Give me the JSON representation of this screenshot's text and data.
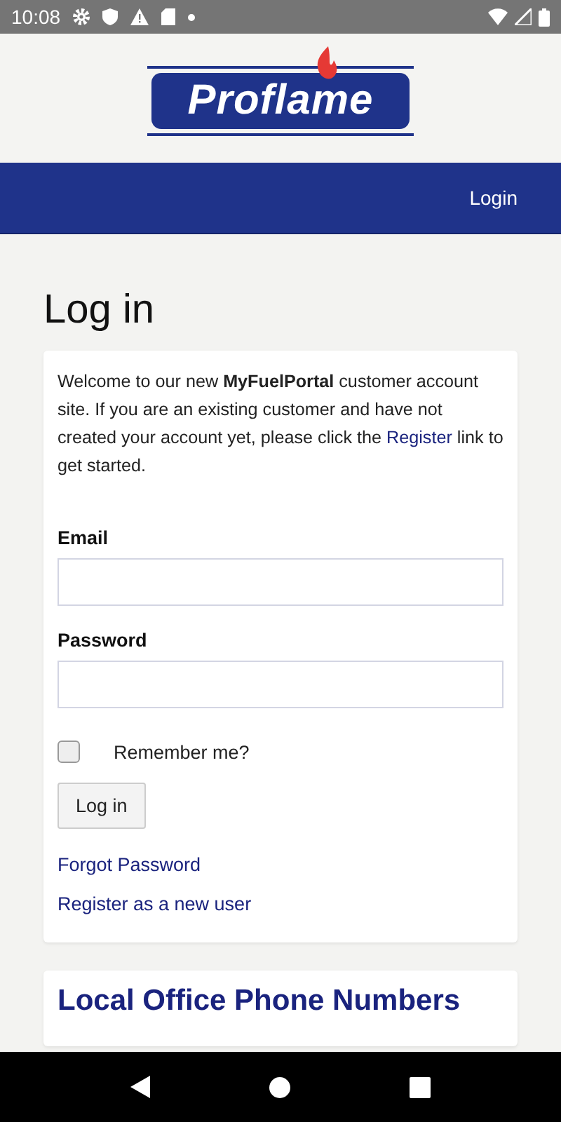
{
  "status_bar": {
    "time": "10:08"
  },
  "header": {
    "logo_text": "Proflame"
  },
  "nav": {
    "items": [
      {
        "label": "Login"
      }
    ]
  },
  "page_title": "Log in",
  "login_card": {
    "intro": {
      "before": "Welcome to our new **MyFuelPortal** customer account site. If you are an existing customer and have not created your account yet, please click the",
      "link": "Register",
      "after": "link to get started."
    },
    "fields": [
      {
        "label": "Email"
      },
      {
        "label": "Password"
      }
    ],
    "remember": {
      "label": "Remember me?",
      "checked": false
    },
    "submit": "Log in",
    "links": [
      "Forgot Password",
      "Register as a new user"
    ]
  },
  "phone_card": {
    "title": "Local Office Phone Numbers"
  }
}
